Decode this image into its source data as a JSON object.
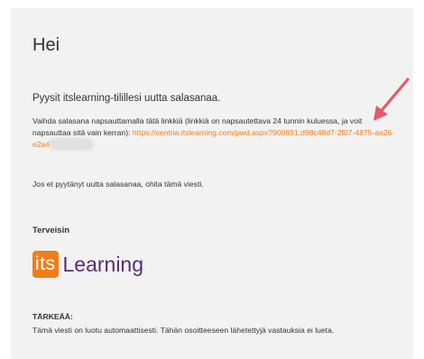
{
  "email": {
    "greeting": "Hei",
    "intro": "Pyysit itslearning-tilillesi uutta salasanaa.",
    "instructions_text": "Vaihda salasana napsauttamalla tätä linkkiä (linkkiä on napsautettava 24 tunnin kuluessa, ja voit napsauttaa sitä vain kerran): ",
    "reset_link": "https://centria.itslearning.com/pwd.aspx?900891;d98c48d7-2f07-4875-aa26-e2a4",
    "ignore_note": "Jos et pyytänyt uutta salasanaa, ohita tämä viesti.",
    "regards": "Terveisin",
    "logo": {
      "badge": "its",
      "word": "Learning",
      "badge_color": "#f07d1a",
      "word_color": "#5b2c6f"
    },
    "important_title": "TÄRKEÄÄ:",
    "important_text": "Tämä viesti on luotu automaattisesti. Tähän osoitteeseen lähetettyjä vastauksia ei lueta."
  },
  "colors": {
    "link": "#f07d1a",
    "arrow": "#e8586a",
    "card_bg": "#f2f2f2",
    "text": "#333333"
  },
  "icons": {
    "annotation": "arrow-icon"
  }
}
